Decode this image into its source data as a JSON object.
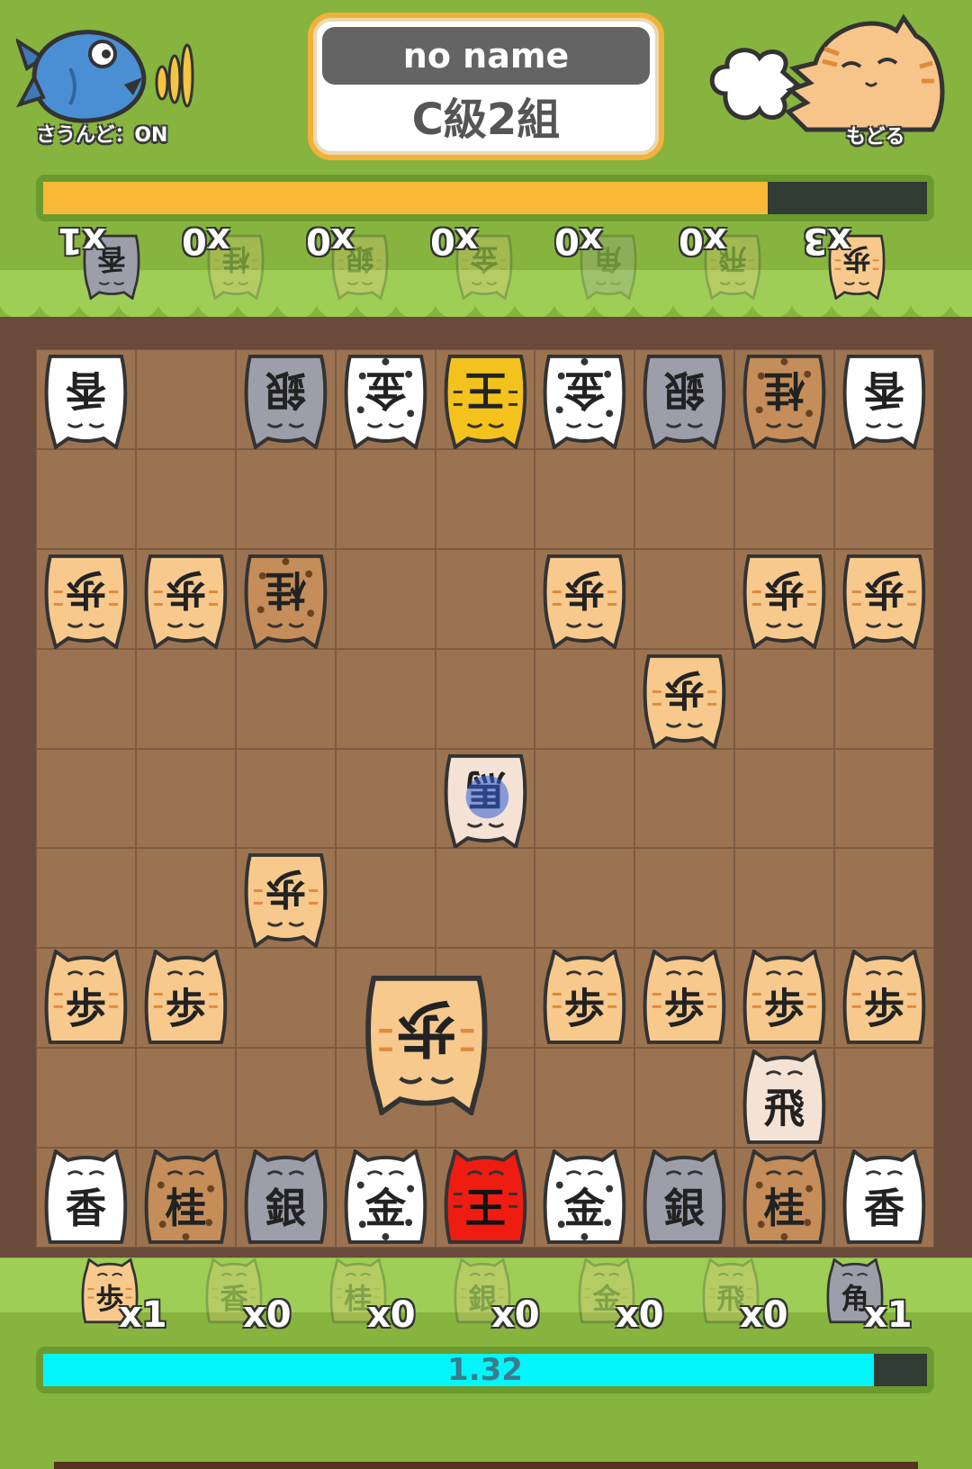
{
  "header": {
    "sound_label": "さうんど：ON",
    "player_name": "no name",
    "player_rank": "C級2組",
    "back_label": "もどる"
  },
  "timers": {
    "opponent_fraction": 0.82,
    "player_fraction": 0.94,
    "player_time_text": "1.32"
  },
  "colors": {
    "background": "#86b43e",
    "opponent_bar": "#f9b938",
    "player_bar": "#00f6fb",
    "board": "#9b7351",
    "frame": "#6a4a3a"
  },
  "opponent_hand": [
    {
      "piece": "香",
      "count": "x1",
      "active": true
    },
    {
      "piece": "桂",
      "count": "x0",
      "active": false
    },
    {
      "piece": "銀",
      "count": "x0",
      "active": false
    },
    {
      "piece": "金",
      "count": "x0",
      "active": false
    },
    {
      "piece": "角",
      "count": "x0",
      "active": false
    },
    {
      "piece": "飛",
      "count": "x0",
      "active": false
    },
    {
      "piece": "歩",
      "count": "x3",
      "active": true
    }
  ],
  "player_hand": [
    {
      "piece": "歩",
      "count": "x1",
      "active": true
    },
    {
      "piece": "香",
      "count": "x0",
      "active": false
    },
    {
      "piece": "桂",
      "count": "x0",
      "active": false
    },
    {
      "piece": "銀",
      "count": "x0",
      "active": false
    },
    {
      "piece": "金",
      "count": "x0",
      "active": false
    },
    {
      "piece": "飛",
      "count": "x0",
      "active": false
    },
    {
      "piece": "角",
      "count": "x1",
      "active": true
    }
  ],
  "board": {
    "pieces": [
      {
        "row": 0,
        "col": 0,
        "char": "香",
        "side": "opponent",
        "style": "white"
      },
      {
        "row": 0,
        "col": 2,
        "char": "銀",
        "side": "opponent",
        "style": "gray"
      },
      {
        "row": 0,
        "col": 3,
        "char": "金",
        "side": "opponent",
        "style": "calico"
      },
      {
        "row": 0,
        "col": 4,
        "char": "王",
        "side": "opponent",
        "style": "gold"
      },
      {
        "row": 0,
        "col": 5,
        "char": "金",
        "side": "opponent",
        "style": "calico"
      },
      {
        "row": 0,
        "col": 6,
        "char": "銀",
        "side": "opponent",
        "style": "gray"
      },
      {
        "row": 0,
        "col": 7,
        "char": "桂",
        "side": "opponent",
        "style": "leopard"
      },
      {
        "row": 0,
        "col": 8,
        "char": "香",
        "side": "opponent",
        "style": "white"
      },
      {
        "row": 2,
        "col": 0,
        "char": "歩",
        "side": "opponent",
        "style": "tabby"
      },
      {
        "row": 2,
        "col": 1,
        "char": "歩",
        "side": "opponent",
        "style": "tabby"
      },
      {
        "row": 2,
        "col": 2,
        "char": "桂",
        "side": "opponent",
        "style": "leopard"
      },
      {
        "row": 2,
        "col": 5,
        "char": "歩",
        "side": "opponent",
        "style": "tabby"
      },
      {
        "row": 2,
        "col": 7,
        "char": "歩",
        "side": "opponent",
        "style": "tabby"
      },
      {
        "row": 2,
        "col": 8,
        "char": "歩",
        "side": "opponent",
        "style": "tabby"
      },
      {
        "row": 3,
        "col": 6,
        "char": "歩",
        "side": "opponent",
        "style": "tabby"
      },
      {
        "row": 4,
        "col": 4,
        "char": "馬",
        "side": "opponent",
        "style": "cream",
        "marked": true
      },
      {
        "row": 5,
        "col": 2,
        "char": "歩",
        "side": "opponent",
        "style": "tabby"
      },
      {
        "row": 6,
        "col": 0,
        "char": "歩",
        "side": "player",
        "style": "tabby"
      },
      {
        "row": 6,
        "col": 1,
        "char": "歩",
        "side": "player",
        "style": "tabby"
      },
      {
        "row": 6,
        "col": 5,
        "char": "歩",
        "side": "player",
        "style": "tabby"
      },
      {
        "row": 6,
        "col": 6,
        "char": "歩",
        "side": "player",
        "style": "tabby"
      },
      {
        "row": 6,
        "col": 7,
        "char": "歩",
        "side": "player",
        "style": "tabby"
      },
      {
        "row": 6,
        "col": 8,
        "char": "歩",
        "side": "player",
        "style": "tabby"
      },
      {
        "row": 7,
        "col": 7,
        "char": "飛",
        "side": "player",
        "style": "cream"
      },
      {
        "row": 8,
        "col": 0,
        "char": "香",
        "side": "player",
        "style": "white"
      },
      {
        "row": 8,
        "col": 1,
        "char": "桂",
        "side": "player",
        "style": "leopard"
      },
      {
        "row": 8,
        "col": 2,
        "char": "銀",
        "side": "player",
        "style": "gray"
      },
      {
        "row": 8,
        "col": 3,
        "char": "金",
        "side": "player",
        "style": "calico"
      },
      {
        "row": 8,
        "col": 4,
        "char": "王",
        "side": "player",
        "style": "red"
      },
      {
        "row": 8,
        "col": 5,
        "char": "金",
        "side": "player",
        "style": "calico"
      },
      {
        "row": 8,
        "col": 6,
        "char": "銀",
        "side": "player",
        "style": "gray"
      },
      {
        "row": 8,
        "col": 7,
        "char": "桂",
        "side": "player",
        "style": "leopard"
      },
      {
        "row": 8,
        "col": 8,
        "char": "香",
        "side": "player",
        "style": "white"
      }
    ],
    "floating_piece": {
      "char": "歩",
      "side": "opponent",
      "style": "tabby",
      "between_cols": [
        3,
        4
      ],
      "between_rows": [
        6,
        7
      ]
    }
  }
}
